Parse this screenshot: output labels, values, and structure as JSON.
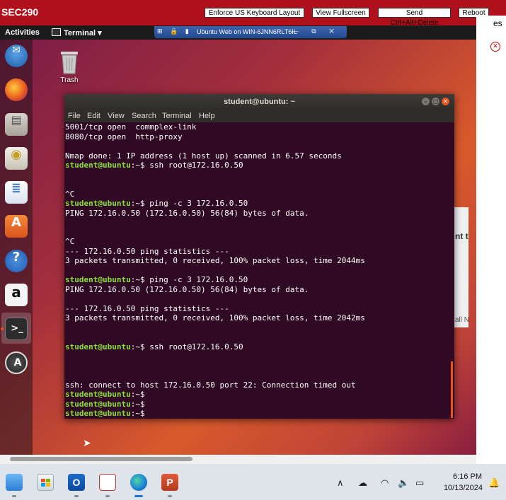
{
  "remote_toolbar": {
    "app_name": "SEC290",
    "buttons": [
      "Enforce US Keyboard Layout",
      "View Fullscreen",
      "Send Ctrl+Alt+Delete",
      "Reboot"
    ]
  },
  "right_strip": {
    "text1": "es",
    "text2": "nt t",
    "text3": "all N"
  },
  "gnome": {
    "activities": "Activities",
    "app_menu": "Terminal ▾"
  },
  "remote_bar": {
    "left_icons": "⊞ 🔒 ▮",
    "title": "Ubuntu Web on WIN-6JNN6RLT6IL",
    "right_icons": "— ⧉ ✕"
  },
  "desktop": {
    "trash_label": "Trash"
  },
  "terminal": {
    "title": "student@ubuntu: ~",
    "menu": [
      "File",
      "Edit",
      "View",
      "Search",
      "Terminal",
      "Help"
    ],
    "prompt": "student@ubuntu",
    "lines": [
      {
        "text": "5001/tcp open  commplex-link"
      },
      {
        "text": "8080/tcp open  http-proxy"
      },
      {
        "text": ""
      },
      {
        "text": "Nmap done: 1 IP address (1 host up) scanned in 6.57 seconds"
      },
      {
        "prompt": "student@ubuntu",
        "text": ":~$ ssh root@172.16.0.50"
      },
      {
        "text": ""
      },
      {
        "text": ""
      },
      {
        "text": "^C"
      },
      {
        "prompt": "student@ubuntu",
        "text": ":~$ ping -c 3 172.16.0.50"
      },
      {
        "text": "PING 172.16.0.50 (172.16.0.50) 56(84) bytes of data."
      },
      {
        "text": ""
      },
      {
        "text": ""
      },
      {
        "text": "^C"
      },
      {
        "text": "--- 172.16.0.50 ping statistics ---"
      },
      {
        "text": "3 packets transmitted, 0 received, 100% packet loss, time 2044ms"
      },
      {
        "text": ""
      },
      {
        "prompt": "student@ubuntu",
        "text": ":~$ ping -c 3 172.16.0.50"
      },
      {
        "text": "PING 172.16.0.50 (172.16.0.50) 56(84) bytes of data."
      },
      {
        "text": ""
      },
      {
        "text": "--- 172.16.0.50 ping statistics ---"
      },
      {
        "text": "3 packets transmitted, 0 received, 100% packet loss, time 2042ms"
      },
      {
        "text": ""
      },
      {
        "text": ""
      },
      {
        "prompt": "student@ubuntu",
        "text": ":~$ ssh root@172.16.0.50"
      },
      {
        "text": ""
      },
      {
        "text": ""
      },
      {
        "text": ""
      },
      {
        "text": "ssh: connect to host 172.16.0.50 port 22: Connection timed out"
      },
      {
        "prompt": "student@ubuntu",
        "text": ":~$"
      },
      {
        "prompt": "student@ubuntu",
        "text": ":~$"
      },
      {
        "prompt": "student@ubuntu",
        "text": ":~$"
      },
      {
        "prompt": "student@ubuntu",
        "text": ":~$ ",
        "cursor": true
      }
    ]
  },
  "dock_icons": [
    "thunderbird-icon",
    "firefox-icon",
    "files-icon",
    "rhythmbox-icon",
    "libreoffice-writer-icon",
    "software-center-icon",
    "help-icon",
    "amazon-icon",
    "terminal-icon",
    "software-updater-icon"
  ],
  "taskbar": {
    "time": "6:16 PM",
    "date": "10/13/2024",
    "apps": [
      "notepad-icon",
      "store-icon",
      "outlook-icon",
      "snipping-tool-icon",
      "edge-icon",
      "powerpoint-icon"
    ]
  },
  "colors": {
    "accent_red": "#b0101c",
    "prompt_green": "#8ae234",
    "terminal_bg": "#300a24",
    "ubuntu_orange": "#e95420"
  }
}
